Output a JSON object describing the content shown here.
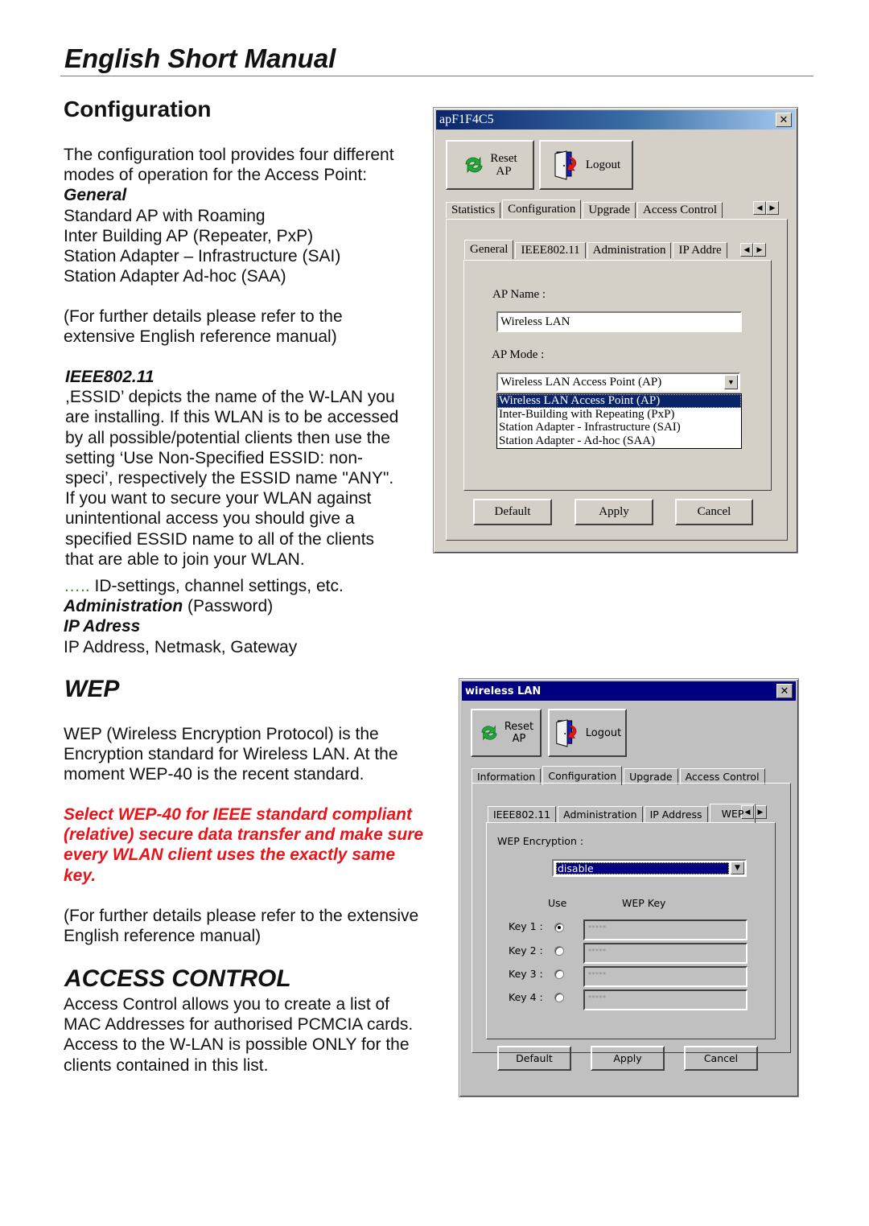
{
  "page": {
    "title": "English Short Manual"
  },
  "configuration": {
    "heading": "Configuration",
    "intro": [
      "The configuration tool provides four different",
      "modes of operation for the Access Point:"
    ],
    "general_label": "General",
    "modes": [
      "Standard AP with Roaming",
      "Inter Building AP (Repeater, PxP)",
      "Station Adapter – Infrastructure (SAI)",
      "Station Adapter Ad-hoc (SAA)"
    ],
    "further": [
      "(For further details please refer to the",
      "extensive English reference manual)"
    ],
    "ieee_label": "IEEE802.11",
    "ieee_text": [
      ",ESSID’ depicts the name of the W-LAN you",
      "are installing. If this WLAN is to be accessed",
      "by all possible/potential clients then use the",
      "setting ‘Use Non-Specified ESSID: non-",
      "speci’, respectively the ESSID name \"ANY\".",
      "If you want to secure your WLAN against",
      "unintentional access you should give a",
      "specified ESSID name to all of the clients",
      "that are able to join your WLAN."
    ],
    "etc_dots": "…..",
    "etc_text": " ID-settings, channel settings, etc.",
    "admin_label": "Administration",
    "admin_text": " (Password)",
    "ip_label": "IP Adress",
    "ip_text": "IP Address, Netmask, Gateway"
  },
  "wep": {
    "heading": "WEP",
    "text": [
      "WEP (Wireless Encryption Protocol) is the",
      "Encryption standard for Wireless LAN. At the",
      "moment WEP-40 is the recent standard."
    ],
    "warning": [
      "Select  WEP-40 for IEEE standard compliant",
      "(relative) secure data transfer and make sure",
      "every WLAN client uses the exactly same",
      "key."
    ],
    "further": [
      "(For further details please refer to the extensive",
      "English reference manual)"
    ]
  },
  "access_control": {
    "heading": "ACCESS CONTROL",
    "text": [
      "Access Control allows you to create a list of",
      "MAC Addresses for authorised PCMCIA cards.",
      "Access to the W-LAN is possible ONLY for the",
      "clients contained in this list."
    ]
  },
  "dialog1": {
    "title": "apF1F4C5",
    "close": "✕",
    "reset_label": [
      "Reset",
      "AP"
    ],
    "logout_label": "Logout",
    "tabs": [
      "Statistics",
      "Configuration",
      "Upgrade",
      "Access Control"
    ],
    "active_tab": "Configuration",
    "subtabs": [
      "General",
      "IEEE802.11",
      "Administration",
      "IP Addre"
    ],
    "active_subtab": "General",
    "ap_name_label": "AP Name :",
    "ap_name_value": "Wireless LAN",
    "ap_mode_label": "AP Mode :",
    "ap_mode_value": "Wireless LAN Access Point (AP)",
    "ap_mode_options": [
      "Wireless LAN Access Point (AP)",
      "Inter-Building with Repeating (PxP)",
      "Station Adapter - Infrastructure (SAI)",
      "Station Adapter - Ad-hoc (SAA)"
    ],
    "buttons": [
      "Default",
      "Apply",
      "Cancel"
    ]
  },
  "dialog2": {
    "title": "wireless LAN",
    "close": "✕",
    "reset_label": [
      "Reset",
      "AP"
    ],
    "logout_label": "Logout",
    "tabs": [
      "Information",
      "Configuration",
      "Upgrade",
      "Access Control"
    ],
    "active_tab": "Configuration",
    "subtabs": [
      "IEEE802.11",
      "Administration",
      "IP Address",
      "WEP"
    ],
    "active_subtab": "WEP",
    "wep_encryption_label": "WEP Encryption :",
    "wep_encryption_value": "disable",
    "use_header": "Use",
    "key_header": "WEP Key",
    "keys": [
      {
        "label": "Key 1 :",
        "selected": true,
        "value": "*****"
      },
      {
        "label": "Key 2 :",
        "selected": false,
        "value": "*****"
      },
      {
        "label": "Key 3 :",
        "selected": false,
        "value": "*****"
      },
      {
        "label": "Key 4 :",
        "selected": false,
        "value": "*****"
      }
    ],
    "buttons": [
      "Default",
      "Apply",
      "Cancel"
    ]
  },
  "icons": {
    "left_arrow": "◀",
    "right_arrow": "▶",
    "dropdown": "▼"
  }
}
